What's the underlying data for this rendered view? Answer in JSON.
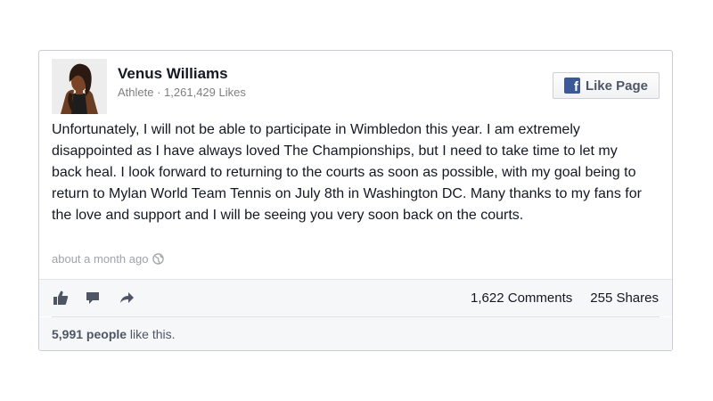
{
  "post": {
    "page_name": "Venus Williams",
    "category": "Athlete",
    "meta_separator": " · ",
    "page_likes": "1,261,429 Likes",
    "like_page_label": "Like Page",
    "text": "Unfortunately, I will not be able to participate in Wimbledon this year. I am extremely disappointed as I have always loved The Championships, but I need to take time to let my back heal. I look forward to returning to the courts as soon as possible, with my goal being to return to Mylan World Team Tennis on July 8th in Washington DC. Many thanks to my fans for the love and support and I will be seeing you very soon back on the courts.",
    "timestamp": "about a month ago"
  },
  "actions": {
    "like_icon": "thumbs-up-icon",
    "comment_icon": "comment-icon",
    "share_icon": "share-arrow-icon",
    "comments": "1,622 Comments",
    "shares": "255 Shares"
  },
  "likes": {
    "count": "5,991 people",
    "suffix": " like this."
  },
  "colors": {
    "facebook_blue": "#3b5998",
    "icon_gray": "#4e5665",
    "muted_gray": "#a0a3a9",
    "bar_background": "#f6f7f8"
  }
}
